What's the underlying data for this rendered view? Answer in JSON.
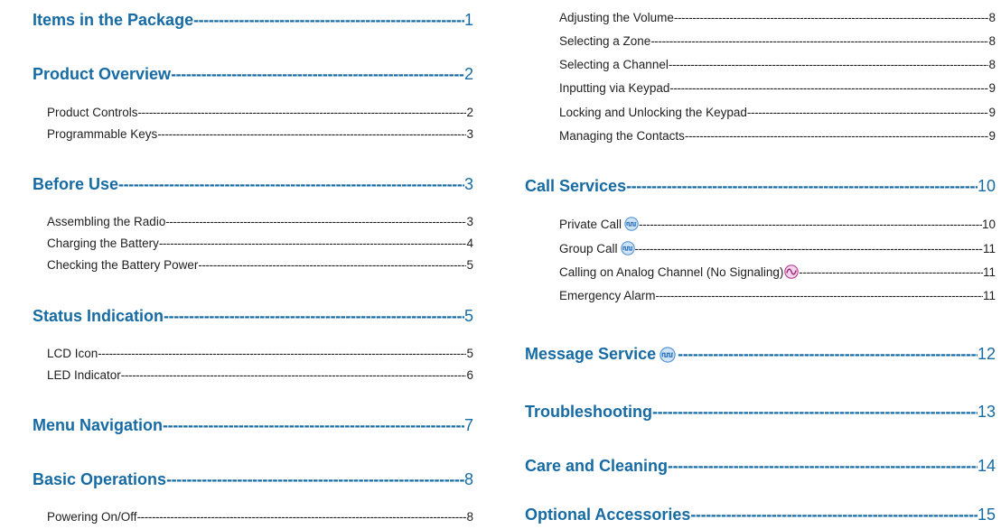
{
  "left": [
    {
      "title": "Items in the Package",
      "page": "1",
      "level": "h"
    },
    {
      "title": "Product Overview",
      "page": "2",
      "level": "h"
    },
    {
      "title": "Product Controls",
      "page": "2",
      "level": "s"
    },
    {
      "title": "Programmable Keys",
      "page": "3",
      "level": "s"
    },
    {
      "title": "Before Use",
      "page": "3",
      "level": "h"
    },
    {
      "title": "Assembling the Radio",
      "page": "3",
      "level": "s"
    },
    {
      "title": "Charging the Battery",
      "page": "4",
      "level": "s"
    },
    {
      "title": "Checking the Battery Power",
      "page": "5",
      "level": "s"
    },
    {
      "title": "Status Indication",
      "page": "5",
      "level": "h"
    },
    {
      "title": "LCD Icon",
      "page": "5",
      "level": "s"
    },
    {
      "title": "LED Indicator",
      "page": "6",
      "level": "s"
    },
    {
      "title": "Menu Navigation",
      "page": "7",
      "level": "h"
    },
    {
      "title": "Basic Operations",
      "page": "8",
      "level": "h"
    },
    {
      "title": "Powering On/Off",
      "page": "8",
      "level": "s"
    }
  ],
  "right": [
    {
      "title": "Adjusting the Volume",
      "page": "8",
      "level": "s"
    },
    {
      "title": "Selecting a Zone",
      "page": "8",
      "level": "s"
    },
    {
      "title": "Selecting a Channel",
      "page": "8",
      "level": "s"
    },
    {
      "title": "Inputting via Keypad",
      "page": "9",
      "level": "s"
    },
    {
      "title": "Locking and Unlocking the Keypad",
      "page": "9",
      "level": "s"
    },
    {
      "title": "Managing the Contacts",
      "page": "9",
      "level": "s"
    },
    {
      "title": "Call Services",
      "page": "10",
      "level": "h"
    },
    {
      "title": "Private Call",
      "page": "10",
      "level": "s",
      "icon": "digital-mode-icon"
    },
    {
      "title": "Group Call",
      "page": "11",
      "level": "s",
      "icon": "digital-mode-icon"
    },
    {
      "title": "Calling on Analog Channel (No Signaling)",
      "page": "11",
      "level": "s",
      "icon": "analog-mode-icon"
    },
    {
      "title": "Emergency Alarm",
      "page": "11",
      "level": "s"
    },
    {
      "title": "Message Service",
      "page": "12",
      "level": "h",
      "icon": "digital-mode-icon"
    },
    {
      "title": "Troubleshooting",
      "page": "13",
      "level": "h"
    },
    {
      "title": "Care and Cleaning",
      "page": "14",
      "level": "h"
    },
    {
      "title": "Optional Accessories",
      "page": "15",
      "level": "h"
    }
  ],
  "colors": {
    "heading": "#166ba4",
    "text": "#1e1e1e",
    "digital_icon": "#4a8fd0",
    "analog_icon": "#b0318a"
  }
}
